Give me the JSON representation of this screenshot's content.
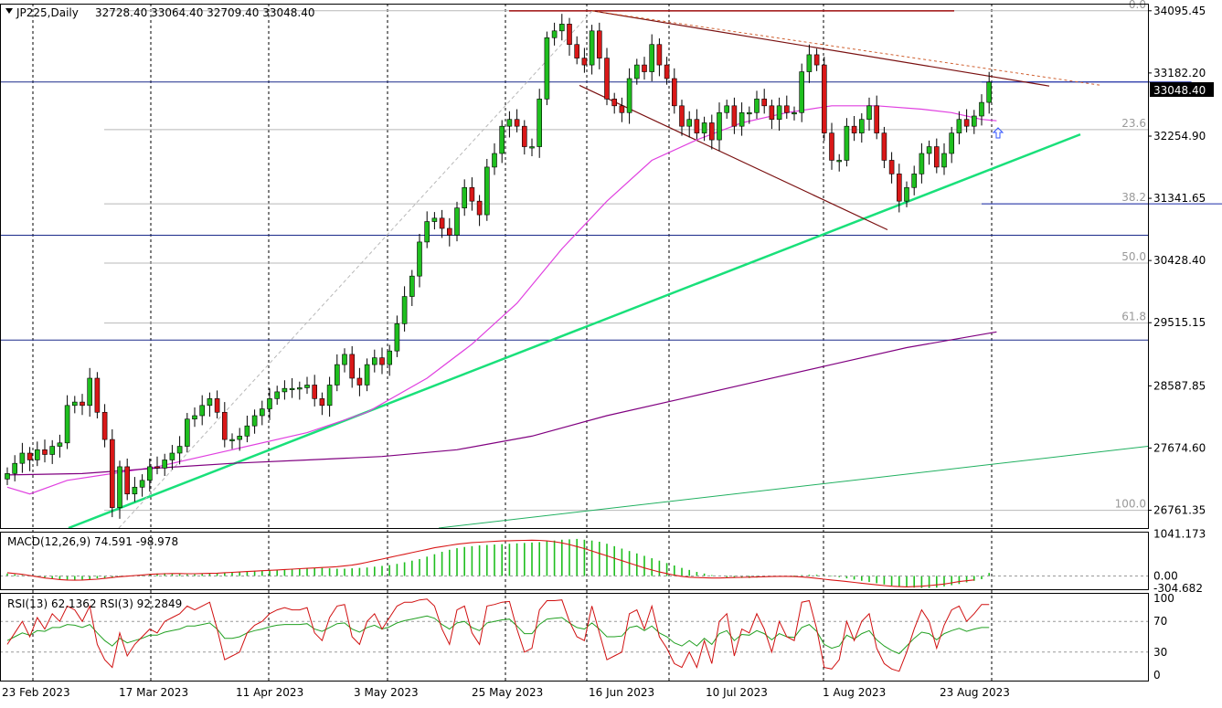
{
  "header": {
    "symbol_label": "JP225,Daily",
    "ohlc": "32728.40 33064.40 32709.40 33048.40"
  },
  "colors": {
    "bull": "#1fbf1f",
    "bear": "#d91818",
    "grid": "#000000",
    "ma_fast": "#e040e0",
    "ma_slow": "#800080",
    "trend_green": "#19e07a",
    "fib": "#b8b8b8",
    "price_tag_bg": "#000000"
  },
  "price_tag": "33048.40",
  "chart_data": [
    {
      "type": "candlestick",
      "panel": "price",
      "x_dates": [
        "23 Feb 2023",
        "17 Mar 2023",
        "11 Apr 2023",
        "3 May 2023",
        "25 May 2023",
        "16 Jun 2023",
        "10 Jul 2023",
        "1 Aug 2023",
        "23 Aug 2023"
      ],
      "y_ticks": [
        "34095.45",
        "33182.20",
        "32254.90",
        "31341.65",
        "30428.40",
        "29515.15",
        "28587.85",
        "27674.60",
        "26761.35"
      ],
      "ylim": [
        26500,
        34200
      ],
      "closes": [
        27300,
        27450,
        27600,
        27500,
        27650,
        27580,
        27700,
        27750,
        28300,
        28350,
        28300,
        28700,
        28200,
        27800,
        26800,
        27400,
        27000,
        27100,
        27200,
        27400,
        27380,
        27500,
        27600,
        27700,
        28100,
        28150,
        28300,
        28400,
        28200,
        27800,
        27800,
        27850,
        28000,
        28150,
        28250,
        28400,
        28500,
        28550,
        28550,
        28560,
        28600,
        28400,
        28300,
        28600,
        28900,
        29050,
        28700,
        28600,
        28900,
        29000,
        28900,
        29100,
        29500,
        29900,
        30200,
        30700,
        31000,
        31050,
        30900,
        30800,
        31200,
        31500,
        31300,
        31100,
        31800,
        32000,
        32400,
        32500,
        32400,
        32100,
        32100,
        32800,
        33700,
        33800,
        33900,
        33600,
        33400,
        33300,
        33800,
        33400,
        32800,
        32700,
        32600,
        33100,
        33300,
        33200,
        33600,
        33300,
        33100,
        32700,
        32400,
        32500,
        32300,
        32450,
        32200,
        32600,
        32700,
        32400,
        32600,
        32600,
        32800,
        32700,
        32500,
        32700,
        32600,
        32600,
        33200,
        33450,
        33300,
        32300,
        31900,
        31900,
        32400,
        32300,
        32500,
        32700,
        32300,
        31900,
        31700,
        31300,
        31500,
        31700,
        32000,
        32100,
        31800,
        32000,
        32300,
        32500,
        32400,
        32550,
        32750,
        33048
      ],
      "ma_fast_points": [
        [
          0,
          27100
        ],
        [
          3,
          27000
        ],
        [
          8,
          27200
        ],
        [
          14,
          27300
        ],
        [
          20,
          27400
        ],
        [
          30,
          27650
        ],
        [
          40,
          27900
        ],
        [
          48,
          28200
        ],
        [
          56,
          28700
        ],
        [
          62,
          29200
        ],
        [
          68,
          29800
        ],
        [
          74,
          30600
        ],
        [
          80,
          31300
        ],
        [
          86,
          31900
        ],
        [
          92,
          32200
        ],
        [
          98,
          32450
        ],
        [
          104,
          32600
        ],
        [
          110,
          32700
        ],
        [
          116,
          32700
        ],
        [
          122,
          32650
        ],
        [
          126,
          32600
        ],
        [
          130,
          32500
        ],
        [
          132,
          32480
        ]
      ],
      "ma_slow_points": [
        [
          0,
          27280
        ],
        [
          10,
          27300
        ],
        [
          20,
          27380
        ],
        [
          30,
          27450
        ],
        [
          40,
          27500
        ],
        [
          50,
          27550
        ],
        [
          60,
          27650
        ],
        [
          70,
          27850
        ],
        [
          80,
          28150
        ],
        [
          90,
          28400
        ],
        [
          100,
          28650
        ],
        [
          110,
          28900
        ],
        [
          120,
          29150
        ],
        [
          132,
          29380
        ]
      ],
      "fib_levels": [
        {
          "label": "0.0",
          "price": 34095.45
        },
        {
          "label": "23.6",
          "price": 32350
        },
        {
          "label": "38.2",
          "price": 31260
        },
        {
          "label": "50.0",
          "price": 30390
        },
        {
          "label": "61.8",
          "price": 29510
        },
        {
          "label": "100.0",
          "price": 26760
        }
      ],
      "hlines": [
        {
          "price": 33050,
          "color": "#1a2a8a"
        },
        {
          "price": 30800,
          "color": "#1a2a8a"
        },
        {
          "price": 29260,
          "color": "#1a2a8a"
        }
      ],
      "resistance_line": {
        "from": [
          85,
          34095
        ],
        "to": [
          131,
          33250
        ]
      },
      "wedge_upper": {
        "from": [
          91,
          34095
        ],
        "to": [
          140,
          32990
        ]
      },
      "wedge_lower": {
        "from": [
          90,
          33000
        ],
        "to": [
          137,
          30850
        ]
      },
      "red_resistance": {
        "from": [
          78,
          34095
        ],
        "to": [
          146,
          34095
        ]
      },
      "trend_green": {
        "from": [
          10,
          26500
        ],
        "to": [
          168,
          32280
        ]
      },
      "trend_green_thin": {
        "from": [
          68,
          26500
        ],
        "to": [
          178,
          27700
        ]
      },
      "short_blue": [
        {
          "from": [
            130,
            33050
          ],
          "to": [
            158,
            33050
          ]
        },
        {
          "from": [
            130,
            31260
          ],
          "to": [
            175,
            31260
          ]
        }
      ]
    },
    {
      "type": "bar",
      "panel": "macd",
      "title": "MACD(12,26,9) 74.591 -98.978",
      "y_ticks": [
        "1041.173",
        "0.00",
        "-304.682"
      ],
      "ylim": [
        -330,
        1100
      ],
      "histogram": [
        60,
        40,
        20,
        0,
        -20,
        -40,
        -60,
        -80,
        -90,
        -100,
        -90,
        -80,
        -60,
        -60,
        -40,
        -20,
        0,
        10,
        30,
        50,
        60,
        70,
        60,
        50,
        40,
        40,
        50,
        60,
        70,
        80,
        100,
        110,
        120,
        130,
        130,
        140,
        150,
        160,
        170,
        180,
        190,
        200,
        200,
        190,
        180,
        180,
        190,
        200,
        210,
        230,
        250,
        270,
        300,
        340,
        380,
        420,
        480,
        540,
        600,
        650,
        690,
        720,
        740,
        760,
        770,
        780,
        790,
        800,
        810,
        820,
        830,
        840,
        860,
        880,
        900,
        910,
        920,
        900,
        880,
        850,
        800,
        740,
        680,
        620,
        560,
        500,
        440,
        380,
        320,
        260,
        200,
        150,
        100,
        60,
        20,
        -10,
        -30,
        -40,
        -50,
        -50,
        -40,
        -30,
        -20,
        -10,
        0,
        10,
        20,
        30,
        30,
        20,
        0,
        -30,
        -60,
        -90,
        -120,
        -150,
        -180,
        -210,
        -240,
        -260,
        -280,
        -290,
        -300,
        -300,
        -290,
        -260,
        -230,
        -200,
        -160,
        -120,
        -80,
        74
      ],
      "signal": [
        80,
        60,
        40,
        10,
        -20,
        -50,
        -70,
        -90,
        -100,
        -105,
        -100,
        -90,
        -80,
        -60,
        -40,
        -20,
        -5,
        10,
        25,
        40,
        50,
        55,
        60,
        60,
        55,
        55,
        60,
        65,
        70,
        80,
        90,
        100,
        110,
        120,
        130,
        140,
        150,
        160,
        170,
        180,
        190,
        200,
        210,
        220,
        230,
        250,
        270,
        300,
        340,
        380,
        420,
        460,
        500,
        540,
        580,
        620,
        660,
        700,
        730,
        760,
        790,
        810,
        830,
        840,
        850,
        860,
        870,
        875,
        880,
        885,
        890,
        885,
        870,
        850,
        820,
        780,
        730,
        680,
        620,
        560,
        500,
        440,
        380,
        320,
        260,
        200,
        150,
        100,
        60,
        20,
        -10,
        -30,
        -40,
        -45,
        -50,
        -50,
        -45,
        -40,
        -35,
        -30,
        -25,
        -20,
        -15,
        -10,
        -10,
        -15,
        -25,
        -40,
        -60,
        -80,
        -100,
        -120,
        -140,
        -160,
        -180,
        -200,
        -220,
        -240,
        -255,
        -265,
        -270,
        -265,
        -255,
        -240,
        -220,
        -200,
        -170,
        -140,
        -120,
        -99
      ]
    },
    {
      "type": "line",
      "panel": "rsi",
      "title": "RSI(13) 62.1362  RSI(3) 92.2849",
      "y_ticks": [
        "100",
        "70",
        "30",
        "0"
      ],
      "ylim": [
        0,
        100
      ],
      "rsi_fast": [
        40,
        55,
        70,
        50,
        75,
        60,
        80,
        70,
        90,
        85,
        70,
        90,
        40,
        20,
        10,
        55,
        25,
        40,
        50,
        60,
        55,
        70,
        75,
        80,
        90,
        85,
        90,
        95,
        60,
        20,
        25,
        30,
        55,
        65,
        70,
        80,
        85,
        88,
        85,
        85,
        88,
        55,
        45,
        75,
        90,
        92,
        50,
        40,
        70,
        80,
        60,
        75,
        90,
        95,
        95,
        98,
        99,
        90,
        60,
        40,
        85,
        90,
        55,
        40,
        90,
        92,
        95,
        96,
        60,
        30,
        35,
        85,
        97,
        97,
        98,
        70,
        50,
        45,
        90,
        55,
        20,
        25,
        30,
        80,
        85,
        60,
        90,
        50,
        35,
        15,
        10,
        30,
        10,
        45,
        15,
        70,
        80,
        25,
        60,
        55,
        80,
        60,
        30,
        70,
        50,
        45,
        95,
        97,
        60,
        10,
        8,
        20,
        70,
        45,
        70,
        80,
        35,
        15,
        8,
        5,
        30,
        60,
        85,
        70,
        35,
        65,
        85,
        90,
        70,
        80,
        92,
        92
      ],
      "rsi_slow": [
        45,
        50,
        55,
        52,
        58,
        57,
        62,
        62,
        66,
        65,
        62,
        66,
        55,
        45,
        38,
        48,
        42,
        45,
        48,
        52,
        52,
        56,
        58,
        60,
        64,
        64,
        66,
        68,
        60,
        48,
        48,
        50,
        55,
        58,
        60,
        63,
        65,
        66,
        66,
        66,
        67,
        60,
        57,
        62,
        67,
        68,
        60,
        56,
        62,
        65,
        60,
        63,
        68,
        71,
        73,
        75,
        77,
        74,
        66,
        60,
        68,
        70,
        62,
        58,
        68,
        70,
        72,
        73,
        64,
        54,
        54,
        66,
        73,
        74,
        75,
        68,
        62,
        60,
        68,
        60,
        50,
        50,
        51,
        62,
        64,
        58,
        64,
        55,
        50,
        42,
        38,
        45,
        38,
        48,
        40,
        54,
        58,
        45,
        53,
        52,
        58,
        54,
        46,
        54,
        50,
        49,
        62,
        66,
        57,
        40,
        35,
        38,
        52,
        47,
        54,
        58,
        46,
        38,
        32,
        28,
        38,
        48,
        56,
        54,
        46,
        54,
        58,
        61,
        57,
        60,
        62,
        62
      ]
    }
  ]
}
